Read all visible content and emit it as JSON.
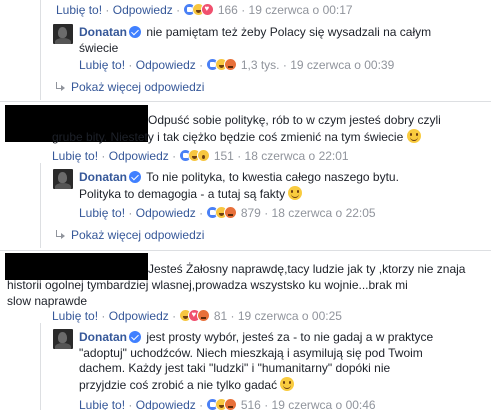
{
  "labels": {
    "like": "Lubię to!",
    "reply": "Odpowiedz",
    "sep": "·"
  },
  "comments": [
    {
      "id": "top_meta",
      "count": "166",
      "date": "19 czerwca o 00:17"
    },
    {
      "id": "donatan_1",
      "author": "Donatan",
      "text": "nie pamiętam też żeby Polacy się wysadzali na całym świecie",
      "count": "1,3 tys.",
      "date": "19 czerwca o 00:39"
    },
    {
      "id": "user_2",
      "text_line1": "Odpuść sobie politykę, rób to w czym jesteś dobry czyli",
      "text_line2": "grube bity. Niestety i tak ciężko będzie coś zmienić na tym świecie",
      "count": "151",
      "date": "18 czerwca o 22:01"
    },
    {
      "id": "donatan_2",
      "author": "Donatan",
      "text": "To nie polityka, to kwestia całego naszego bytu. Polityka to demagogia - a tutaj są fakty",
      "count": "879",
      "date": "18 czerwca o 22:05"
    },
    {
      "id": "user_3",
      "text_line1": "Jesteś Żałosny naprawdę,tacy ludzie jak ty ,ktorzy nie znaja",
      "text_line2": "historii ogolnej tymbardziej wlasnej,prowadza wszystsko ku wojnie...brak mi",
      "text_line3": "slow naprawde",
      "count": "81",
      "date": "19 czerwca o 00:25"
    },
    {
      "id": "donatan_3",
      "author": "Donatan",
      "text": "jest prosty wybór, jesteś za - to nie gadaj a w praktyce \"adoptuj\" uchodźców. Niech mieszkają i asymilują się pod Twoim dachem. Każdy jest taki \"ludzki\" i \"humanitarny\" dopóki nie przyjdzie coś zrobić a nie tylko gadać",
      "count": "516",
      "date": "19 czerwca o 00:46"
    }
  ],
  "more_replies": [
    {
      "label": "Pokaż więcej odpowiedzi"
    },
    {
      "label": "Pokaż więcej odpowiedzi"
    }
  ]
}
